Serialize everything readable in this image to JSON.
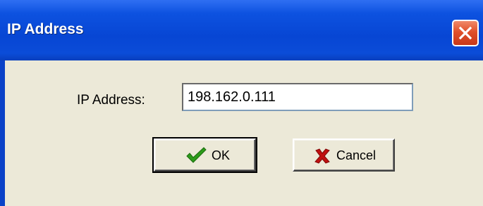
{
  "window": {
    "title": "IP Address",
    "close_icon": "close-icon"
  },
  "form": {
    "label": "IP Address:",
    "ip_value": "198.162.0.111"
  },
  "buttons": {
    "ok_label": "OK",
    "ok_icon": "checkmark-icon",
    "cancel_label": "Cancel",
    "cancel_icon": "red-x-icon"
  },
  "colors": {
    "titlebar": "#0746d4",
    "close_button": "#e0502a",
    "dialog_background": "#ece9d8",
    "ok_icon": "#2c9b1a",
    "cancel_icon": "#c01010"
  }
}
